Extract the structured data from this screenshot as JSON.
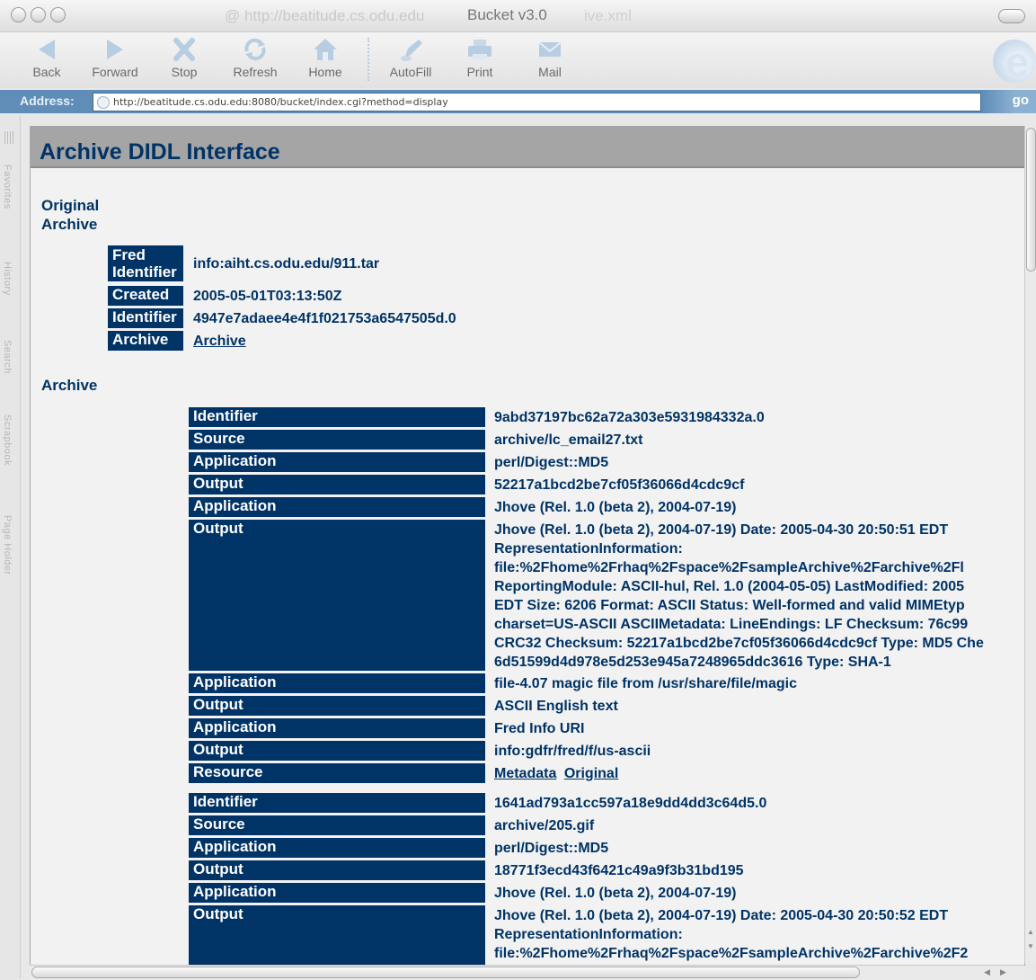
{
  "window": {
    "title": "Bucket v3.0",
    "ghost_left": "@ http://beatitude.cs.odu.edu",
    "ghost_right": "ive.xml"
  },
  "toolbar": {
    "buttons": [
      {
        "label": "Back",
        "icon": "back-arrow-icon"
      },
      {
        "label": "Forward",
        "icon": "forward-arrow-icon"
      },
      {
        "label": "Stop",
        "icon": "stop-x-icon"
      },
      {
        "label": "Refresh",
        "icon": "refresh-icon"
      },
      {
        "label": "Home",
        "icon": "home-icon"
      },
      {
        "label": "AutoFill",
        "icon": "autofill-icon"
      },
      {
        "label": "Print",
        "icon": "printer-icon"
      },
      {
        "label": "Mail",
        "icon": "mail-icon"
      }
    ],
    "logo": "e"
  },
  "address": {
    "label": "Address:",
    "url": "http://beatitude.cs.odu.edu:8080/bucket/index.cgi?method=display",
    "go_label": "go"
  },
  "sidebar": {
    "tabs": [
      "Favorites",
      "History",
      "Search",
      "Scrapbook",
      "Page Holder"
    ]
  },
  "page": {
    "title": "Archive DIDL Interface",
    "original_section": {
      "title_line1": "Original",
      "title_line2": "Archive",
      "rows": [
        {
          "label_line1": "Fred",
          "label_line2": "Identifier",
          "value": "info:aiht.cs.odu.edu/911.tar"
        },
        {
          "label": "Created",
          "value": "2005-05-01T03:13:50Z"
        },
        {
          "label": "Identifier",
          "value": "4947e7adaee4e4f1f021753a6547505d.0"
        },
        {
          "label": "Archive",
          "link": "Archive"
        }
      ]
    },
    "archive_section": {
      "title": "Archive",
      "item1": {
        "rows": [
          {
            "label": "Identifier",
            "value": "9abd37197bc62a72a303e5931984332a.0"
          },
          {
            "label": "Source",
            "value": "archive/lc_email27.txt"
          },
          {
            "label": "Application",
            "value": "perl/Digest::MD5"
          },
          {
            "label": "Output",
            "value": "52217a1bcd2be7cf05f36066d4cdc9cf"
          },
          {
            "label": "Application",
            "value": "Jhove (Rel. 1.0 (beta 2), 2004-07-19)"
          },
          {
            "label": "Output",
            "lines": [
              "Jhove (Rel. 1.0 (beta 2), 2004-07-19) Date: 2005-04-30 20:50:51 EDT",
              "RepresentationInformation:",
              "file:%2Fhome%2Frhaq%2Fspace%2FsampleArchive%2Farchive%2Fl",
              "ReportingModule: ASCII-hul, Rel. 1.0 (2004-05-05) LastModified: 2005",
              "EDT Size: 6206 Format: ASCII Status: Well-formed and valid MIMEtyp",
              "charset=US-ASCII ASCIIMetadata: LineEndings: LF Checksum: 76c99",
              "CRC32 Checksum: 52217a1bcd2be7cf05f36066d4cdc9cf Type: MD5 Che",
              "6d51599d4d978e5d253e945a7248965ddc3616 Type: SHA-1"
            ]
          },
          {
            "label": "Application",
            "value": "file-4.07 magic file from /usr/share/file/magic"
          },
          {
            "label": "Output",
            "value": "ASCII English text"
          },
          {
            "label": "Application",
            "value": "Fred Info URI"
          },
          {
            "label": "Output",
            "value": "info:gdfr/fred/f/us-ascii"
          },
          {
            "label": "Resource",
            "links": [
              "Metadata",
              "Original"
            ]
          }
        ]
      },
      "item2": {
        "rows": [
          {
            "label": "Identifier",
            "value": "1641ad793a1cc597a18e9dd4dd3c64d5.0"
          },
          {
            "label": "Source",
            "value": "archive/205.gif"
          },
          {
            "label": "Application",
            "value": "perl/Digest::MD5"
          },
          {
            "label": "Output",
            "value": "18771f3ecd43f6421c49a9f3b31bd195"
          },
          {
            "label": "Application",
            "value": "Jhove (Rel. 1.0 (beta 2), 2004-07-19)"
          },
          {
            "label": "Output",
            "lines": [
              "Jhove (Rel. 1.0 (beta 2), 2004-07-19) Date: 2005-04-30 20:50:52 EDT",
              "RepresentationInformation:",
              "file:%2Fhome%2Frhaq%2Fspace%2FsampleArchive%2Farchive%2F2"
            ]
          }
        ]
      }
    }
  },
  "colors": {
    "label_bg": "#003366",
    "text": "#003366",
    "address_bar": "#5f8db7"
  }
}
